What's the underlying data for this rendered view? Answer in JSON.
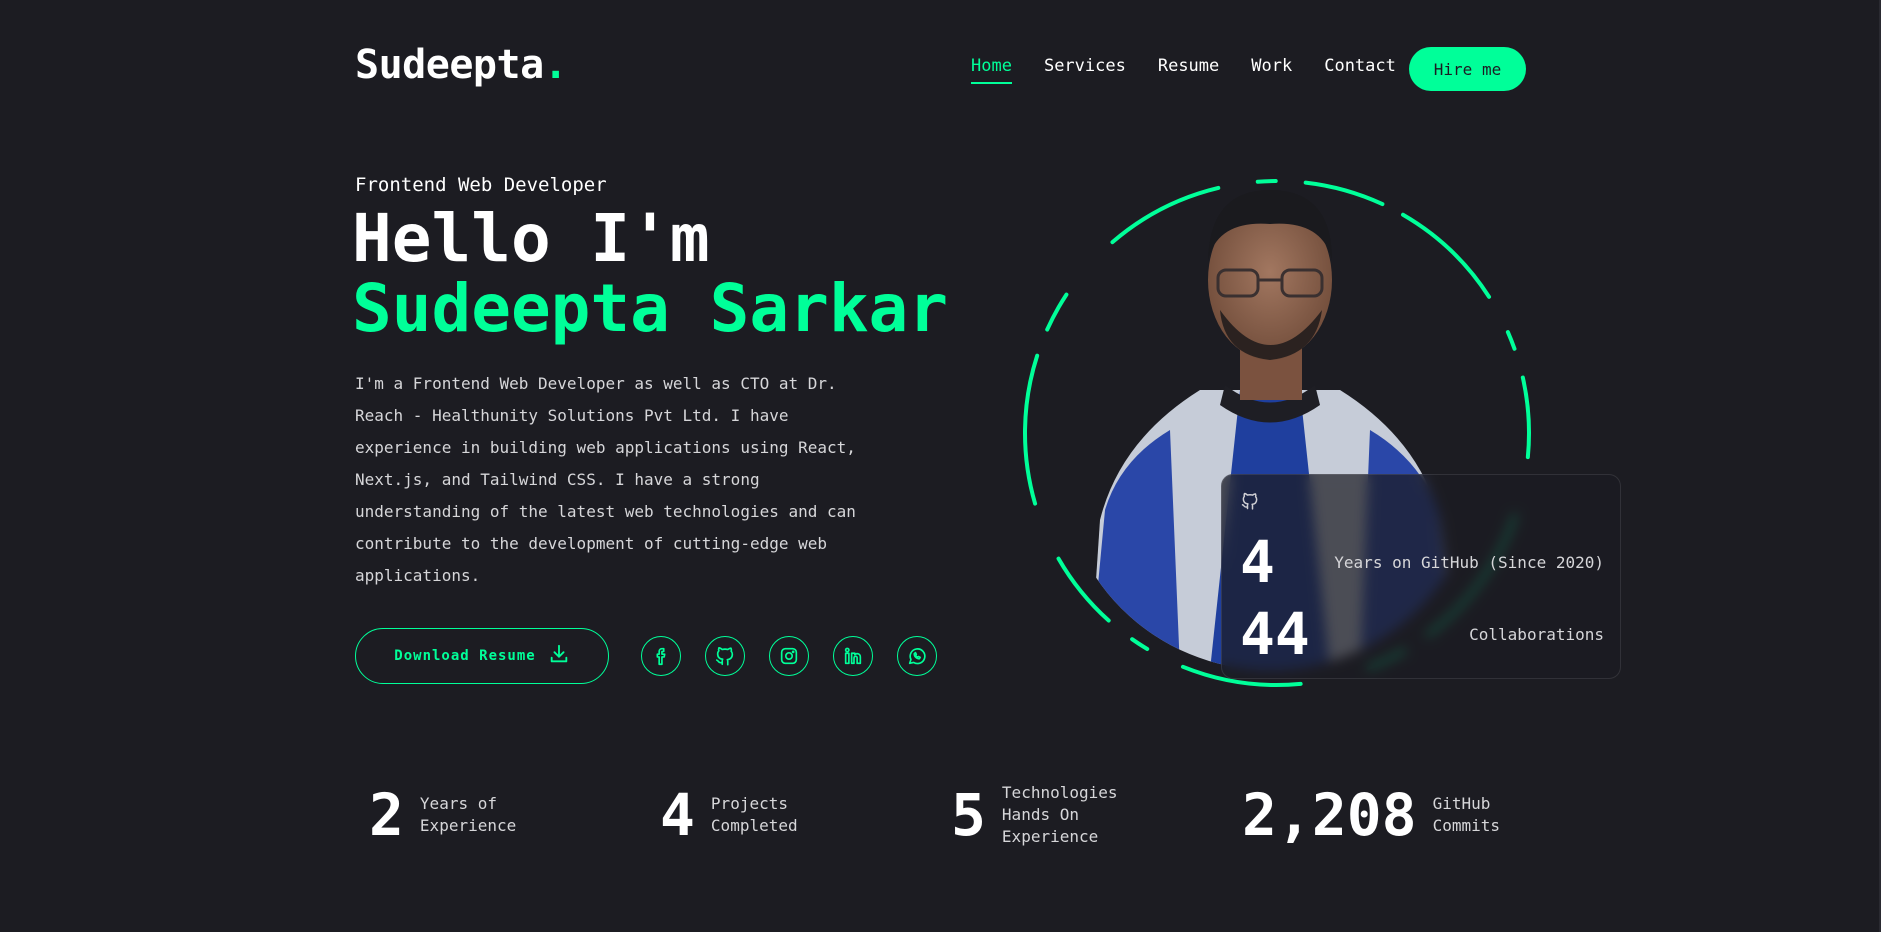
{
  "header": {
    "logo_text": "Sudeepta",
    "logo_dot": ".",
    "nav": [
      "Home",
      "Services",
      "Resume",
      "Work",
      "Contact"
    ],
    "active_nav": "Home",
    "hire_label": "Hire me"
  },
  "hero": {
    "role": "Frontend Web Developer",
    "greeting": "Hello I'm",
    "name": "Sudeepta Sarkar",
    "bio": "I'm a Frontend Web Developer as well as CTO at Dr. Reach - Healthunity Solutions Pvt Ltd. I have experience in building web applications using React, Next.js, and Tailwind CSS. I have a strong understanding of the latest web technologies and can contribute to the development of cutting-edge web applications.",
    "download_label": "Download Resume",
    "socials": [
      "facebook-icon",
      "github-icon",
      "instagram-icon",
      "linkedin-icon",
      "whatsapp-icon"
    ]
  },
  "github_card": {
    "icon": "github-icon",
    "rows": [
      {
        "num": "4",
        "label": "Years on GitHub (Since 2020)"
      },
      {
        "num": "44",
        "label": "Collaborations"
      }
    ]
  },
  "stats": [
    {
      "num": "2",
      "label": "Years of\nExperience"
    },
    {
      "num": "4",
      "label": "Projects\nCompleted"
    },
    {
      "num": "5",
      "label": "Technologies\nHands On\nExperience"
    },
    {
      "num": "2,208",
      "label": "GitHub\nCommits"
    }
  ],
  "colors": {
    "accent": "#00ff99",
    "background": "#1c1c22"
  }
}
